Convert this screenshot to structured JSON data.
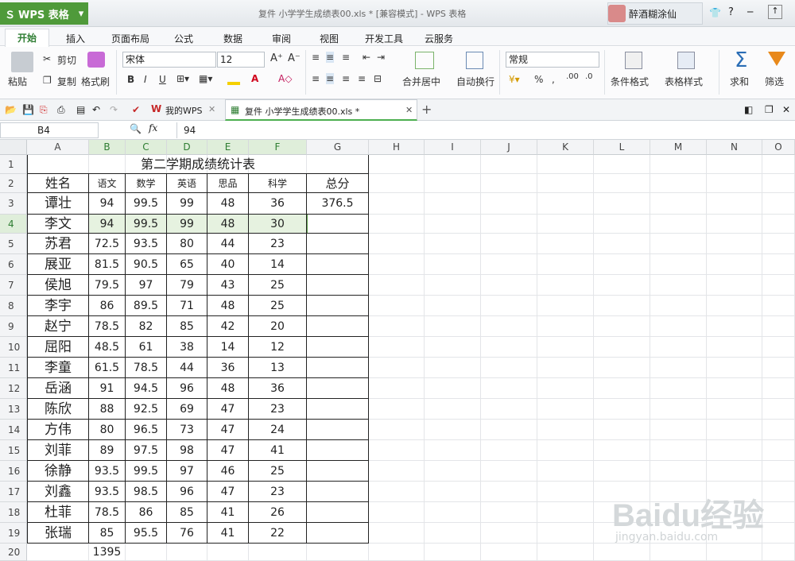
{
  "app": {
    "brand": "WPS 表格",
    "title": "复件 小学学生成绩表00.xls * [兼容模式] - WPS 表格",
    "user": "醉酒糊涂仙"
  },
  "ribbon": {
    "tabs": [
      "开始",
      "插入",
      "页面布局",
      "公式",
      "数据",
      "审阅",
      "视图",
      "开发工具",
      "云服务"
    ]
  },
  "toolbar": {
    "paste": "粘贴",
    "cut": "剪切",
    "copy": "复制",
    "format_painter": "格式刷",
    "font": "宋体",
    "font_size": "12",
    "bold": "B",
    "italic": "I",
    "underline": "U",
    "merge": "合并居中",
    "wrap": "自动换行",
    "number_format": "常规",
    "percent": "%",
    "cond_format": "条件格式",
    "table_style": "表格样式",
    "sum": "求和",
    "filter": "筛选",
    "sum_glyph": "Σ"
  },
  "doctabs": {
    "my": "我的WPS",
    "file": "复件 小学学生成绩表00.xls *",
    "add": "+"
  },
  "formula_bar": {
    "namebox": "B4",
    "fx": "fx",
    "value": "94"
  },
  "columns": [
    "A",
    "B",
    "C",
    "D",
    "E",
    "F",
    "G",
    "H",
    "I",
    "J",
    "K",
    "L",
    "M",
    "N",
    "O"
  ],
  "rows": [
    "1",
    "2",
    "3",
    "4",
    "5",
    "6",
    "7",
    "8",
    "9",
    "10",
    "11",
    "12",
    "13",
    "14",
    "15",
    "16",
    "17",
    "18",
    "19",
    "20",
    "21"
  ],
  "sheet": {
    "title": "第二学期成绩统计表",
    "headers": [
      "姓名",
      "语文",
      "数学",
      "英语",
      "思品",
      "科学",
      "总分"
    ],
    "students": [
      [
        "谭壮",
        "94",
        "99.5",
        "99",
        "48",
        "36",
        "376.5"
      ],
      [
        "李文",
        "94",
        "99.5",
        "99",
        "48",
        "30",
        ""
      ],
      [
        "苏君",
        "72.5",
        "93.5",
        "80",
        "44",
        "23",
        ""
      ],
      [
        "展亚",
        "81.5",
        "90.5",
        "65",
        "40",
        "14",
        ""
      ],
      [
        "侯旭",
        "79.5",
        "97",
        "79",
        "43",
        "25",
        ""
      ],
      [
        "李宇",
        "86",
        "89.5",
        "71",
        "48",
        "25",
        ""
      ],
      [
        "赵宁",
        "78.5",
        "82",
        "85",
        "42",
        "20",
        ""
      ],
      [
        "屈阳",
        "48.5",
        "61",
        "38",
        "14",
        "12",
        ""
      ],
      [
        "李童",
        "61.5",
        "78.5",
        "44",
        "36",
        "13",
        ""
      ],
      [
        "岳涵",
        "91",
        "94.5",
        "96",
        "48",
        "36",
        ""
      ],
      [
        "陈欣",
        "88",
        "92.5",
        "69",
        "47",
        "23",
        ""
      ],
      [
        "方伟",
        "80",
        "96.5",
        "73",
        "47",
        "24",
        ""
      ],
      [
        "刘菲",
        "89",
        "97.5",
        "98",
        "47",
        "41",
        ""
      ],
      [
        "徐静",
        "93.5",
        "99.5",
        "97",
        "46",
        "25",
        ""
      ],
      [
        "刘鑫",
        "93.5",
        "98.5",
        "96",
        "47",
        "23",
        ""
      ],
      [
        "杜菲",
        "78.5",
        "86",
        "85",
        "41",
        "26",
        ""
      ],
      [
        "张瑞",
        "85",
        "95.5",
        "76",
        "41",
        "22",
        ""
      ]
    ],
    "row20_b": "1395"
  },
  "watermark": {
    "main": "Baidu经验",
    "sub": "jingyan.baidu.com"
  }
}
